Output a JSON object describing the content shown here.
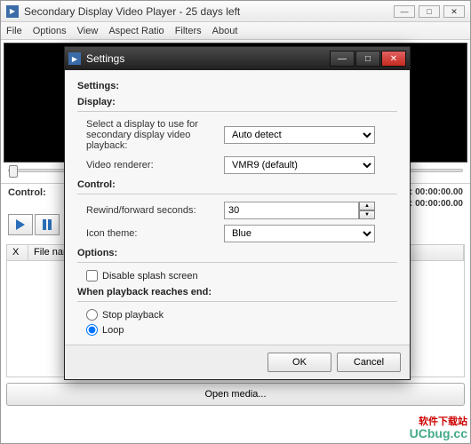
{
  "main": {
    "title": "Secondary Display Video Player - 25 days left",
    "menu": [
      "File",
      "Options",
      "View",
      "Aspect Ratio",
      "Filters",
      "About"
    ],
    "control_label": "Control:",
    "position_label": "sition:",
    "position_value": "00:00:00.00",
    "length_label": "ngth:",
    "length_value": "00:00:00.00",
    "playlist_cols": {
      "x": "X",
      "filename": "File name"
    },
    "open_media": "Open media..."
  },
  "dialog": {
    "title": "Settings",
    "heading": "Settings:",
    "display": {
      "group": "Display:",
      "select_label": "Select a display to use for secondary display video playback:",
      "display_value": "Auto detect",
      "renderer_label": "Video renderer:",
      "renderer_value": "VMR9 (default)"
    },
    "control": {
      "group": "Control:",
      "rewind_label": "Rewind/forward seconds:",
      "rewind_value": "30",
      "icon_theme_label": "Icon theme:",
      "icon_theme_value": "Blue"
    },
    "options": {
      "group": "Options:",
      "disable_splash": "Disable splash screen"
    },
    "playback_end": {
      "group": "When playback reaches end:",
      "stop": "Stop playback",
      "loop": "Loop"
    },
    "buttons": {
      "ok": "OK",
      "cancel": "Cancel"
    }
  },
  "watermark": {
    "line1": "软件下载站",
    "line2": "UCbug.cc"
  }
}
